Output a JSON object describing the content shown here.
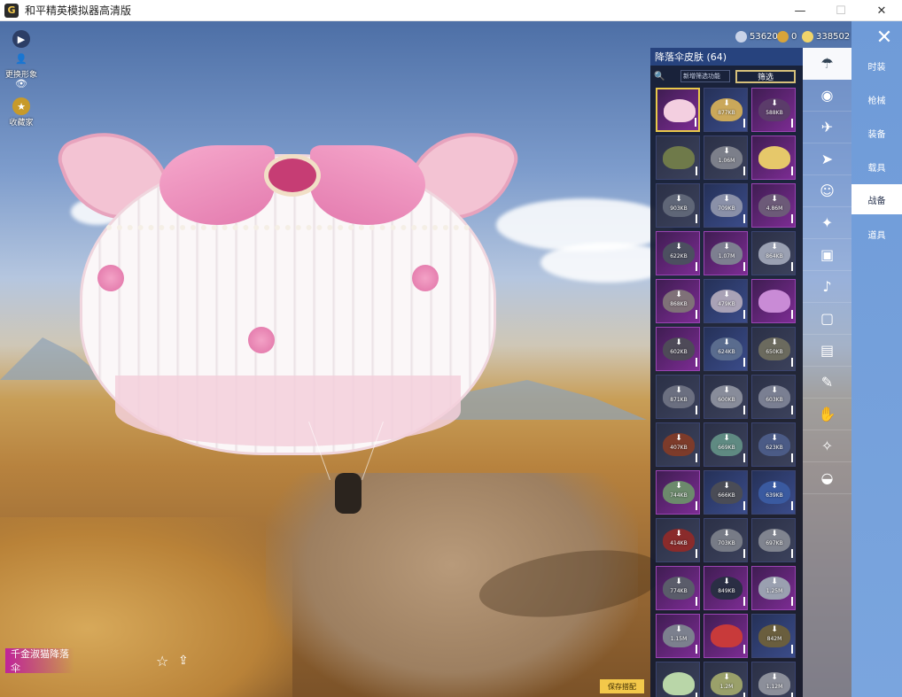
{
  "window": {
    "title": "和平精英模拟器高清版",
    "icon": "game-logo-icon",
    "controls": [
      "—",
      "☐",
      "✕"
    ]
  },
  "left_tools": [
    {
      "icon": "play-icon",
      "glyph": "▶",
      "label": ""
    },
    {
      "icon": "user-icon",
      "glyph": "👤",
      "label": "更换形象"
    },
    {
      "icon": "eye-icon",
      "glyph": "👁",
      "label": ""
    },
    {
      "icon": "collection-icon",
      "glyph": "★",
      "label": "收藏家"
    }
  ],
  "currency": [
    {
      "icon": "silver-coin-icon",
      "value": "53620",
      "color": "#c9d3e8"
    },
    {
      "icon": "gold-coin-icon",
      "value": "0",
      "color": "#d8a43a"
    },
    {
      "icon": "coupon-icon",
      "value": "338502",
      "color": "#f0d46a"
    }
  ],
  "panel": {
    "title": "降落伞皮肤 (64)",
    "search_icon": "search-icon",
    "filter_placeholder": "新增筛选功能",
    "filter_button": "筛选",
    "items": [
      {
        "size": "",
        "style": "purple",
        "color": "#f3cfe0",
        "selected": true
      },
      {
        "size": "877KB",
        "style": "blue",
        "color": "#caa85a"
      },
      {
        "size": "588KB",
        "style": "purple",
        "color": "#5b3c6a"
      },
      {
        "size": "",
        "style": "grey",
        "color": "#6f7a4a"
      },
      {
        "size": "1.06M",
        "style": "grey",
        "color": "#7c7f8a"
      },
      {
        "size": "",
        "style": "purple",
        "color": "#e6c86a"
      },
      {
        "size": "903KB",
        "style": "grey",
        "color": "#5f6677"
      },
      {
        "size": "709KB",
        "style": "blue",
        "color": "#8a90a8"
      },
      {
        "size": "4.86M",
        "style": "purple",
        "color": "#6c5a78"
      },
      {
        "size": "622KB",
        "style": "purple",
        "color": "#4c4f60"
      },
      {
        "size": "1.07M",
        "style": "purple",
        "color": "#7d7f90"
      },
      {
        "size": "864KB",
        "style": "grey",
        "color": "#9aa0b2"
      },
      {
        "size": "868KB",
        "style": "purple",
        "color": "#7f7178"
      },
      {
        "size": "479KB",
        "style": "blue",
        "color": "#a9a2b6"
      },
      {
        "size": "",
        "style": "purple",
        "color": "#c98bd6"
      },
      {
        "size": "602KB",
        "style": "purple",
        "color": "#4e4a58"
      },
      {
        "size": "624KB",
        "style": "blue",
        "color": "#5a6c8e"
      },
      {
        "size": "650KB",
        "style": "grey",
        "color": "#6b6a5e"
      },
      {
        "size": "871KB",
        "style": "grey",
        "color": "#6b6f80"
      },
      {
        "size": "600KB",
        "style": "grey",
        "color": "#888c9a"
      },
      {
        "size": "603KB",
        "style": "grey",
        "color": "#7a7f92"
      },
      {
        "size": "407KB",
        "style": "grey",
        "color": "#7d3b2a"
      },
      {
        "size": "669KB",
        "style": "grey",
        "color": "#5f8a82"
      },
      {
        "size": "623KB",
        "style": "grey",
        "color": "#4b5b86"
      },
      {
        "size": "744KB",
        "style": "purple",
        "color": "#6c8a6c"
      },
      {
        "size": "666KB",
        "style": "blue",
        "color": "#4a4c56"
      },
      {
        "size": "639KB",
        "style": "blue",
        "color": "#3a5aa0"
      },
      {
        "size": "414KB",
        "style": "grey",
        "color": "#8a2b2b"
      },
      {
        "size": "703KB",
        "style": "grey",
        "color": "#777b86"
      },
      {
        "size": "697KB",
        "style": "grey",
        "color": "#80848f"
      },
      {
        "size": "774KB",
        "style": "purple",
        "color": "#5a5c6a"
      },
      {
        "size": "849KB",
        "style": "purple",
        "color": "#2a2e44"
      },
      {
        "size": "1.25M",
        "style": "purple",
        "color": "#9aa0b0"
      },
      {
        "size": "1.15M",
        "style": "purple",
        "color": "#7c808e"
      },
      {
        "size": "",
        "style": "purple",
        "color": "#c83a3a"
      },
      {
        "size": "842M",
        "style": "blue",
        "color": "#6a5e3e"
      },
      {
        "size": "",
        "style": "grey",
        "color": "#b9d6a8"
      },
      {
        "size": "1.2M",
        "style": "grey",
        "color": "#9aa06a"
      },
      {
        "size": "1.12M",
        "style": "grey",
        "color": "#8c8f9a"
      }
    ]
  },
  "categories": [
    {
      "icon": "parachute-icon",
      "glyph": "☂",
      "active": true
    },
    {
      "icon": "eye-mask-icon",
      "glyph": "◉",
      "active": false
    },
    {
      "icon": "plane-icon",
      "glyph": "✈",
      "active": false
    },
    {
      "icon": "glider-icon",
      "glyph": "➤",
      "active": false
    },
    {
      "icon": "emote-icon",
      "glyph": "☺",
      "active": false
    },
    {
      "icon": "wings-icon",
      "glyph": "✦",
      "active": false
    },
    {
      "icon": "backpack-icon",
      "glyph": "▣",
      "active": false
    },
    {
      "icon": "sound-icon",
      "glyph": "♪",
      "active": false
    },
    {
      "icon": "box-icon",
      "glyph": "▢",
      "active": false
    },
    {
      "icon": "photo-icon",
      "glyph": "▤",
      "active": false
    },
    {
      "icon": "spray-icon",
      "glyph": "✎",
      "active": false
    },
    {
      "icon": "hand-icon",
      "glyph": "✋",
      "active": false
    },
    {
      "icon": "magic-wand-icon",
      "glyph": "✧",
      "active": false
    },
    {
      "icon": "trail-icon",
      "glyph": "◒",
      "active": false
    }
  ],
  "tabs": [
    {
      "label": "时装",
      "active": false
    },
    {
      "label": "枪械",
      "active": false
    },
    {
      "label": "装备",
      "active": false
    },
    {
      "label": "载具",
      "active": false
    },
    {
      "label": "战备",
      "active": true
    },
    {
      "label": "道具",
      "active": false
    }
  ],
  "close_glyph": "✕",
  "selected_item_name": "千金淑猫降落伞",
  "star_glyph": "☆",
  "share_glyph": "⇪",
  "save_button": "保存搭配",
  "download_glyph": "⬇"
}
